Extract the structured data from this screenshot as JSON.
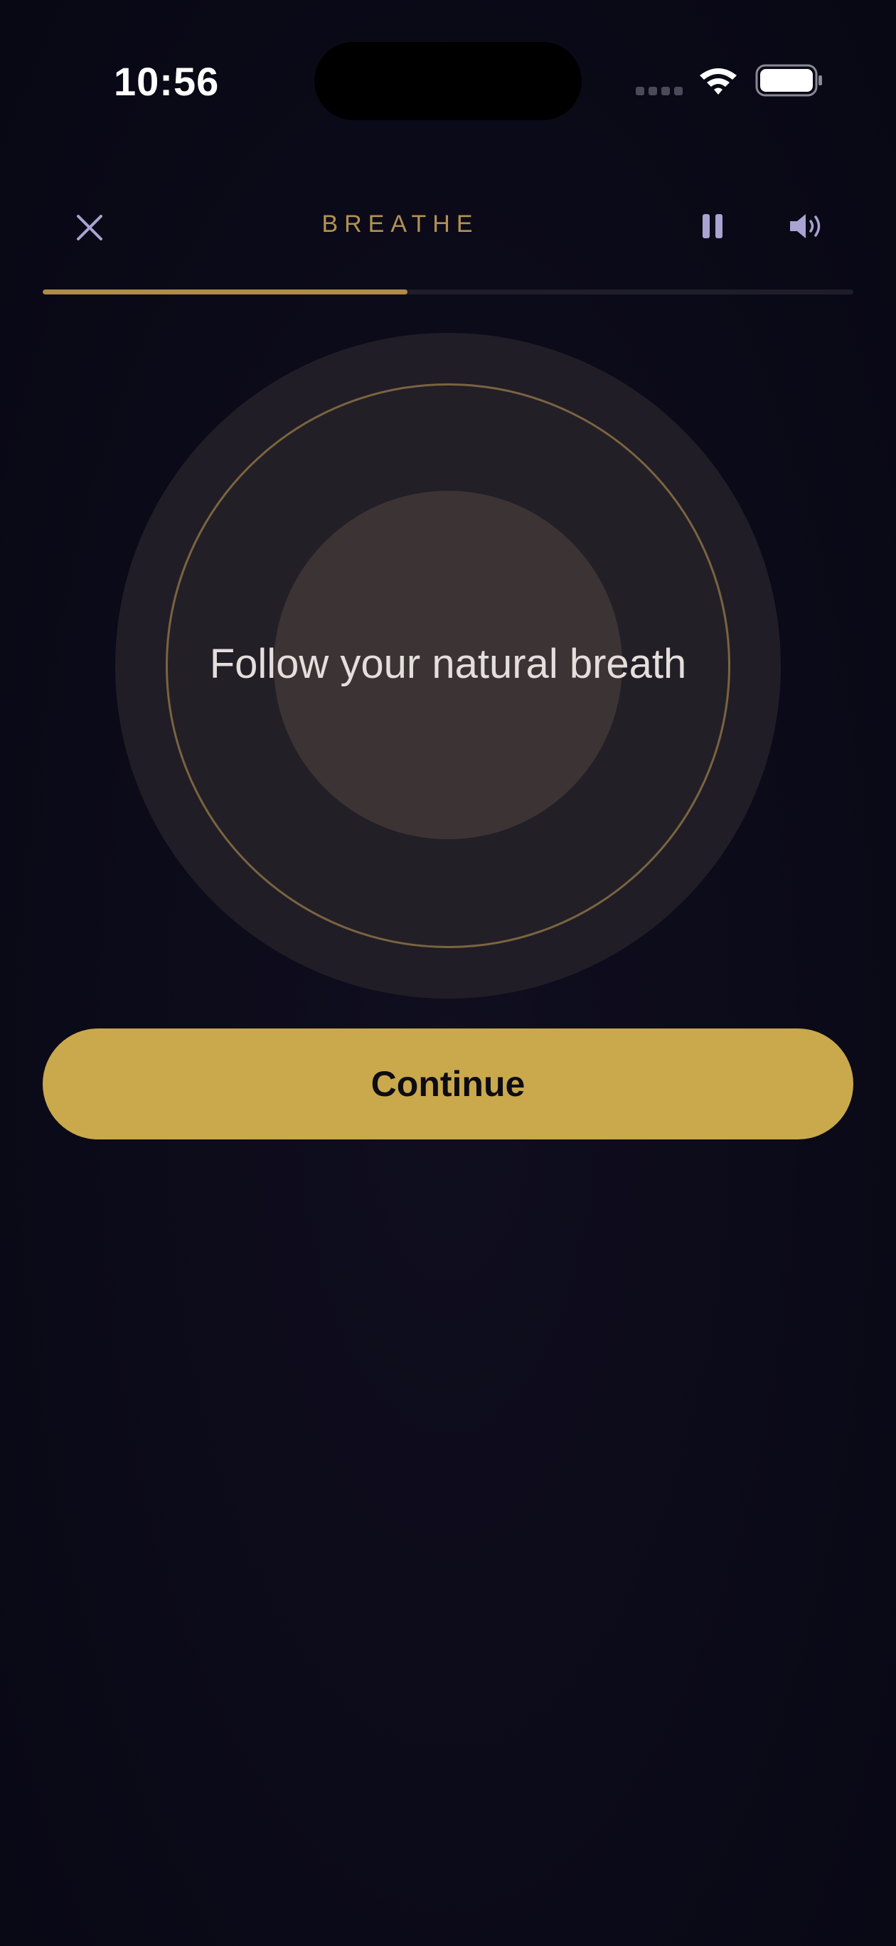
{
  "status_bar": {
    "time": "10:56"
  },
  "header": {
    "title": "BREATHE",
    "close_icon": "close-icon",
    "pause_icon": "pause-icon",
    "volume_icon": "volume-icon"
  },
  "progress": {
    "fraction": 0.45
  },
  "breath": {
    "instruction": "Follow your natural breath"
  },
  "actions": {
    "continue_label": "Continue"
  },
  "colors": {
    "accent": "#c9a94c",
    "progress": "#b08c48",
    "icon": "#a8a3d0",
    "background": "#0c0b19"
  }
}
